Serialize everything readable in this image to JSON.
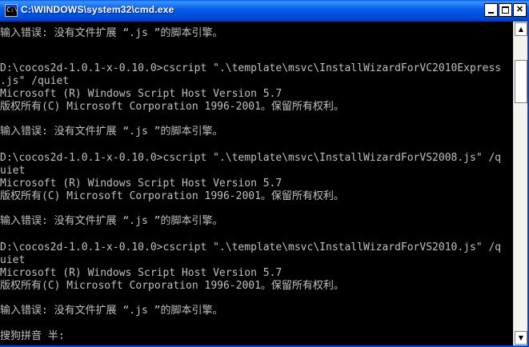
{
  "window": {
    "title": "C:\\WINDOWS\\system32\\cmd.exe",
    "icon": "cmd-icon",
    "controls": {
      "minimize": "minimize-icon",
      "maximize": "maximize-icon",
      "close": "✕"
    }
  },
  "console": {
    "lines": [
      "输入错误: 没有文件扩展 “.js ”的脚本引擎。",
      "",
      "D:\\cocos2d-1.0.1-x-0.10.0>cscript \".\\template\\msvc\\InstallWizardForVC2010Express",
      ".js\" /quiet",
      "Microsoft (R) Windows Script Host Version 5.7",
      "版权所有(C) Microsoft Corporation 1996-2001。保留所有权利。",
      "",
      "输入错误: 没有文件扩展 “.js ”的脚本引擎。",
      "",
      "D:\\cocos2d-1.0.1-x-0.10.0>cscript \".\\template\\msvc\\InstallWizardForVS2008.js\" /q",
      "uiet",
      "Microsoft (R) Windows Script Host Version 5.7",
      "版权所有(C) Microsoft Corporation 1996-2001。保留所有权利。",
      "",
      "输入错误: 没有文件扩展 “.js ”的脚本引擎。",
      "",
      "D:\\cocos2d-1.0.1-x-0.10.0>cscript \".\\template\\msvc\\InstallWizardForVS2010.js\" /q",
      "uiet",
      "Microsoft (R) Windows Script Host Version 5.7",
      "版权所有(C) Microsoft Corporation 1996-2001。保留所有权利。",
      "",
      "输入错误: 没有文件扩展 “.js ”的脚本引擎。",
      "",
      "搜狗拼音 半:"
    ]
  },
  "scrollbar": {
    "up_icon": "▲",
    "down_icon": "▼"
  },
  "colors": {
    "console_bg": "#000000",
    "console_text": "#c0c0c0",
    "titlebar": "#0a61e8"
  }
}
